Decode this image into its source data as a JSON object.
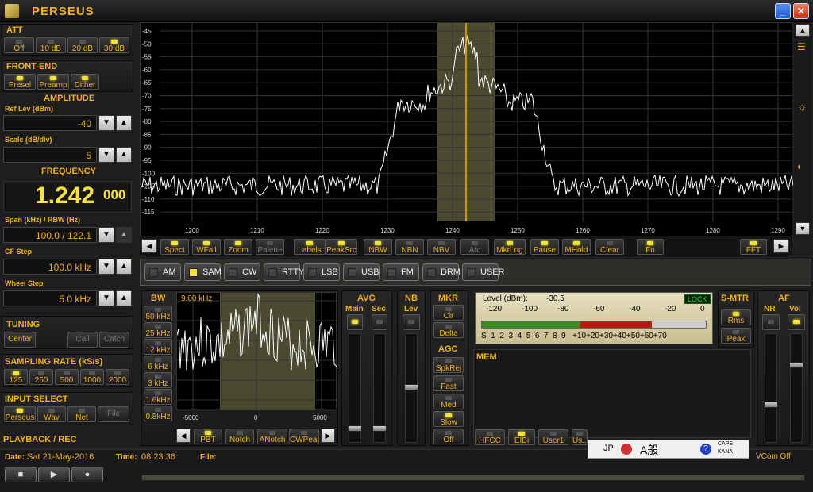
{
  "window": {
    "title": "PERSEUS"
  },
  "att": {
    "title": "ATT",
    "buttons": [
      "Off",
      "10 dB",
      "20 dB",
      "30 dB"
    ],
    "active": 3
  },
  "frontend": {
    "title": "FRONT-END",
    "buttons": [
      "Presel",
      "Preamp",
      "Dither"
    ]
  },
  "amplitude": {
    "title": "AMPLITUDE",
    "ref_label": "Ref Lev (dBm)",
    "ref_value": "-40",
    "scale_label": "Scale (dB/div)",
    "scale_value": "5"
  },
  "frequency": {
    "title": "FREQUENCY",
    "main": "1.242",
    "sub": "000",
    "span_label": "Span (kHz) / RBW (Hz)",
    "span_value": "100.0 / 122.1",
    "cf_label": "CF Step",
    "cf_value": "100.0 kHz",
    "wheel_label": "Wheel Step",
    "wheel_value": "5.0 kHz"
  },
  "tuning": {
    "title": "TUNING",
    "buttons": [
      "Center",
      "Call",
      "Catch"
    ]
  },
  "sampling": {
    "title": "SAMPLING RATE (kS/s)",
    "buttons": [
      "125",
      "250",
      "500",
      "1000",
      "2000"
    ],
    "active": 0
  },
  "input": {
    "title": "INPUT SELECT",
    "buttons": [
      "Perseus",
      "Wav",
      "Net",
      "File"
    ],
    "active": 0
  },
  "playback": {
    "title": "PLAYBACK / REC",
    "date_label": "Date:",
    "date_value": "Sat 21-May-2016",
    "time_label": "Time:",
    "time_value": "08:23:36",
    "file_label": "File:",
    "file_value": ""
  },
  "spectrum": {
    "y_ticks": [
      "-45",
      "-50",
      "-55",
      "-60",
      "-65",
      "-70",
      "-75",
      "-80",
      "-85",
      "-90",
      "-95",
      "-100",
      "-105",
      "-110",
      "-115"
    ],
    "x_ticks": [
      "1200",
      "1210",
      "1220",
      "1230",
      "1240",
      "1250",
      "1260",
      "1270",
      "1280",
      "1290"
    ],
    "toolbar": [
      "Spect",
      "WFall",
      "Zoom",
      "Palette",
      "Labels",
      "PeakSrc",
      "NBW",
      "NBN",
      "NBV",
      "Afc",
      "MkrLog",
      "Pause",
      "MHold",
      "Clear",
      "Fn",
      "FFT"
    ]
  },
  "modes": {
    "items": [
      "AM",
      "SAM",
      "CW",
      "RTTY",
      "LSB",
      "USB",
      "FM",
      "DRM",
      "USER"
    ],
    "active": 1
  },
  "bw": {
    "title": "BW",
    "items": [
      "50 kHz",
      "25 kHz",
      "12 kHz",
      "6 kHz",
      "3 kHz",
      "1.6kHz",
      "0.8kHz"
    ],
    "display": "9.00 kHz",
    "x_ticks": [
      "-5000",
      "0",
      "5000"
    ],
    "bottom": [
      "PBT",
      "Notch",
      "ANotch",
      "CWPeak"
    ]
  },
  "avg": {
    "title": "AVG",
    "main": "Main",
    "sec": "Sec"
  },
  "nb": {
    "title": "NB",
    "lev": "Lev"
  },
  "mkr": {
    "title": "MKR",
    "buttons": [
      "Clr",
      "Delta"
    ]
  },
  "agc": {
    "title": "AGC",
    "buttons": [
      "SpkRej",
      "Fast",
      "Med",
      "Slow",
      "Off"
    ]
  },
  "smeter": {
    "level_label": "Level (dBm):",
    "level_value": "-30.5",
    "lock": "LOCK",
    "scale_top": [
      "-120",
      "-100",
      "-80",
      "-60",
      "-40",
      "-20",
      "0"
    ],
    "scale_bottom": "S  1  2  3  4  5  6  7  8  9   +10+20+30+40+50+60+70",
    "level_fraction": 0.76
  },
  "smtr": {
    "title": "S-MTR",
    "buttons": [
      "Rms",
      "Peak"
    ]
  },
  "af": {
    "title": "AF",
    "nr": "NR",
    "vol": "Vol"
  },
  "mem": {
    "title": "MEM",
    "buttons": [
      "HFCC",
      "EIBi",
      "User1",
      "Us..."
    ]
  },
  "status": {
    "lang": "JP",
    "caps": "CAPS",
    "kana": "KANA",
    "vcom": "VCom Off"
  },
  "colors": {
    "accent": "#f0b020",
    "trace": "#ffffff",
    "passband": "#4a4a30",
    "smeter_green": "#3a8a20",
    "smeter_red": "#b02010"
  }
}
